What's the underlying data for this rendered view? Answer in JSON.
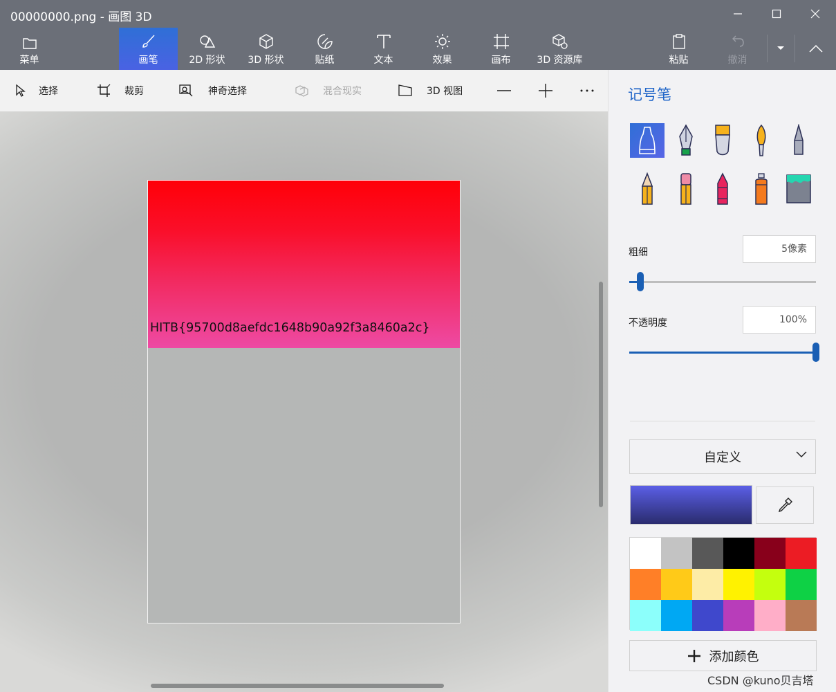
{
  "window": {
    "title": "00000000.png - 画图 3D"
  },
  "ribbon": {
    "menu": "菜单",
    "brushes": "画笔",
    "shapes2d": "2D 形状",
    "shapes3d": "3D 形状",
    "stickers": "贴纸",
    "text": "文本",
    "effects": "效果",
    "canvas": "画布",
    "library3d": "3D 资源库",
    "paste": "粘贴",
    "undo": "撤消"
  },
  "toolbar": {
    "select": "选择",
    "crop": "裁剪",
    "magic_select": "神奇选择",
    "mixed_reality": "混合现实",
    "view3d": "3D 视图"
  },
  "canvas": {
    "text": "HITB{95700d8aefdc1648b90a92f3a8460a2c}"
  },
  "panel": {
    "title": "记号笔",
    "brushes": [
      "marker-icon",
      "calligraphy-pen-icon",
      "oil-brush-icon",
      "watercolor-icon",
      "pixel-pen-icon",
      "pencil-icon",
      "eraser-icon",
      "crayon-icon",
      "spray-can-icon",
      "fill-bucket-icon"
    ],
    "thickness_label": "粗细",
    "thickness_value": "5像素",
    "thickness_level": 0.06,
    "opacity_label": "不透明度",
    "opacity_value": "100%",
    "opacity_level": 1.0,
    "color_mode": "自定义",
    "current_color_top": "#5b5fe6",
    "current_color_bottom": "#2a2c6e",
    "palette": [
      "#ffffff",
      "#c3c3c3",
      "#585858",
      "#000000",
      "#88001b",
      "#ec1c24",
      "#ff7f27",
      "#ffca18",
      "#fdeca6",
      "#fff200",
      "#c4ff0e",
      "#0ed145",
      "#8cfffb",
      "#00a8f3",
      "#3f48cc",
      "#b83dba",
      "#ffaec8",
      "#b97a56"
    ],
    "add_color": "添加颜色"
  },
  "watermark": "CSDN @kuno贝吉塔"
}
